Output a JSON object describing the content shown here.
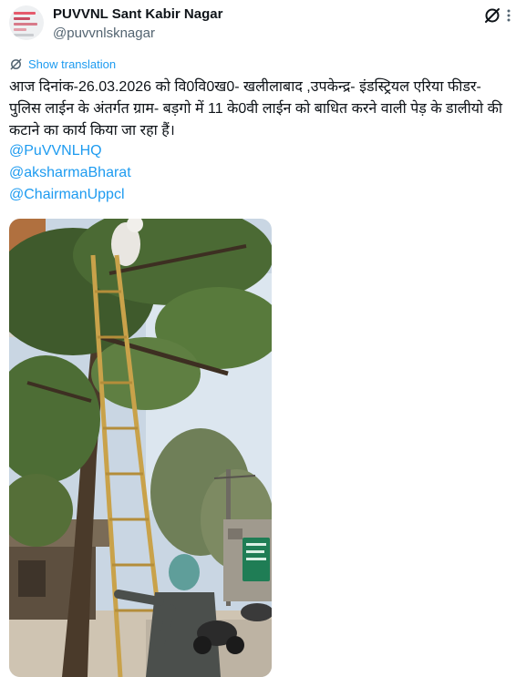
{
  "account": {
    "display_name": "PUVVNL Sant Kabir Nagar",
    "handle": "@puvvnlsknagar",
    "avatar_icon": "logo-avatar"
  },
  "actions": {
    "grok_icon": "grok-icon",
    "more_icon": "more-dots-icon"
  },
  "translation": {
    "label": "Show translation",
    "icon": "translate-icon"
  },
  "tweet": {
    "text": "आज दिनांक-26.03.2026 को वि0वि0ख0- खलीलाबाद ,उपकेन्द्र-  इंडस्ट्रियल एरिया फीडर-  पुलिस लाईन  के अंतर्गत  ग्राम- बड़गो में  11 के0वी लाईन को बाधित करने वाली पेड़ के डालीयो की कटाने का कार्य किया जा रहा हैं।",
    "mentions": [
      "@PuVVNLHQ",
      "@aksharmaBharat",
      "@ChairmanUppcl"
    ]
  },
  "colors": {
    "link": "#1d9bf0",
    "text": "#0f1419",
    "muted": "#536471"
  }
}
